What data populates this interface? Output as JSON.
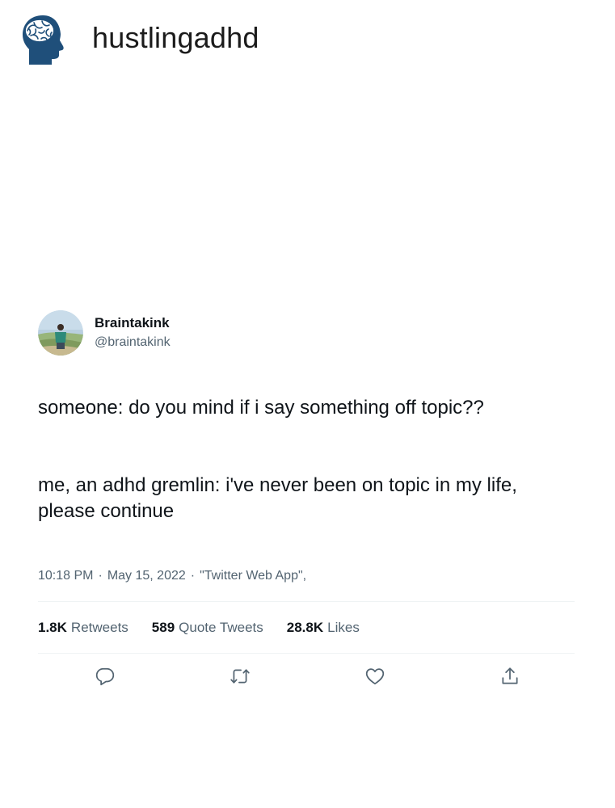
{
  "header": {
    "brand_name": "hustlingadhd",
    "logo_icon": "head-brain-icon",
    "logo_color": "#1f4f7a"
  },
  "tweet": {
    "author": {
      "display_name": "Braintakink",
      "handle": "@braintakink"
    },
    "text": {
      "line1": "someone: do you mind if i say something off topic??",
      "line2": "me, an adhd gremlin: i've never been on topic in my life, please continue"
    },
    "meta": {
      "time": "10:18 PM",
      "separator": "·",
      "date": "May 15, 2022",
      "source": "\"Twitter Web App\","
    },
    "stats": {
      "retweets_count": "1.8K",
      "retweets_label": "Retweets",
      "quotes_count": "589",
      "quotes_label": "Quote Tweets",
      "likes_count": "28.8K",
      "likes_label": "Likes"
    },
    "actions": {
      "reply_icon": "reply-icon",
      "retweet_icon": "retweet-icon",
      "like_icon": "heart-icon",
      "share_icon": "share-icon"
    }
  },
  "colors": {
    "text_primary": "#0f1419",
    "text_secondary": "#536471",
    "divider": "#eff3f4"
  }
}
